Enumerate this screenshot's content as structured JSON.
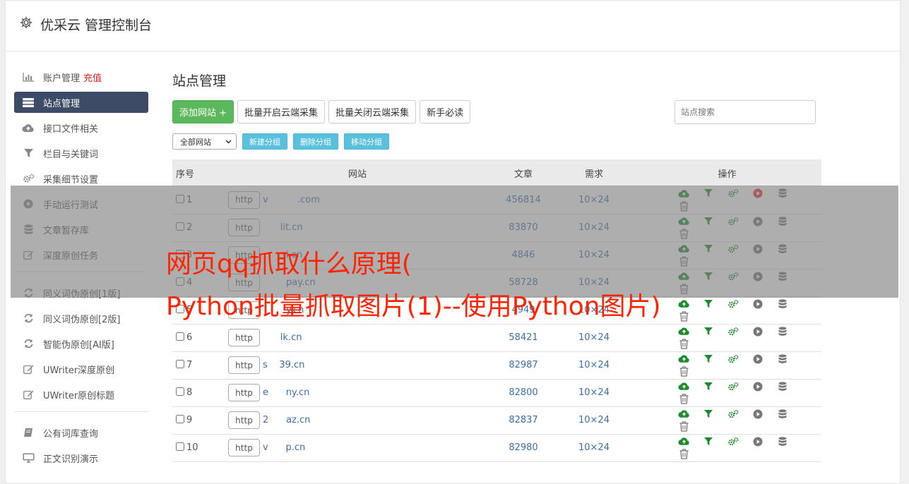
{
  "app": {
    "title": "优采云 管理控制台"
  },
  "sidebar": {
    "group1": [
      {
        "label": "账户管理",
        "extra": "充值",
        "icon": "bar-chart-icon"
      },
      {
        "label": "站点管理",
        "icon": "server-icon",
        "active": true
      },
      {
        "label": "接口文件相关",
        "icon": "cloud-upload-icon"
      },
      {
        "label": "栏目与关键词",
        "icon": "filter-icon"
      },
      {
        "label": "采集细节设置",
        "icon": "cogs-icon"
      },
      {
        "label": "手动运行测试",
        "icon": "play-icon"
      },
      {
        "label": "文章暂存库",
        "icon": "database-icon"
      },
      {
        "label": "深度原创任务",
        "icon": "edit-icon"
      }
    ],
    "group2": [
      {
        "label": "同义词伪原创[1版]",
        "icon": "refresh-icon"
      },
      {
        "label": "同义词伪原创[2版]",
        "icon": "refresh-icon"
      },
      {
        "label": "智能伪原创[AI版]",
        "icon": "refresh-icon"
      },
      {
        "label": "UWriter深度原创",
        "icon": "edit-icon"
      },
      {
        "label": "UWriter原创标题",
        "icon": "edit-icon"
      }
    ],
    "group3": [
      {
        "label": "公有词库查询",
        "icon": "book-icon"
      },
      {
        "label": "正文识别演示",
        "icon": "monitor-icon"
      }
    ]
  },
  "main": {
    "title": "站点管理",
    "toolbar": {
      "add_site": "添加网站 +",
      "batch_open": "批量开启云端采集",
      "batch_close": "批量关闭云端采集",
      "guide": "新手必读"
    },
    "search_placeholder": "站点搜索",
    "group_select": "全部网站",
    "group_buttons": {
      "new": "新建分组",
      "delete": "删除分组",
      "move": "移动分组"
    },
    "table": {
      "headers": {
        "no": "序号",
        "site": "网站",
        "articles": "文章",
        "demand": "需求",
        "ops": "操作"
      },
      "http_label": "http",
      "rows": [
        {
          "no": "1",
          "domain": "v          .com",
          "articles": "456814",
          "demand": "10×24",
          "running": true
        },
        {
          "no": "2",
          "domain": "      lit.cn",
          "articles": "83870",
          "demand": "10×24",
          "running": false
        },
        {
          "no": "3",
          "domain": "        i.cn",
          "articles": "4846",
          "demand": "10×24",
          "running": false
        },
        {
          "no": "4",
          "domain": "        pay.cn",
          "articles": "58728",
          "demand": "10×24",
          "running": false
        },
        {
          "no": "5",
          "domain": "        y.cn",
          "articles": "4949",
          "demand": "10×24",
          "running": false
        },
        {
          "no": "6",
          "domain": "      lk.cn",
          "articles": "58421",
          "demand": "10×24",
          "running": false
        },
        {
          "no": "7",
          "domain": "s    39.cn",
          "articles": "82987",
          "demand": "10×24",
          "running": false
        },
        {
          "no": "8",
          "domain": "e      ny.cn",
          "articles": "82800",
          "demand": "10×24",
          "running": false
        },
        {
          "no": "9",
          "domain": "2      az.cn",
          "articles": "82837",
          "demand": "10×24",
          "running": false
        },
        {
          "no": "10",
          "domain": "v      p.cn",
          "articles": "82980",
          "demand": "10×24",
          "running": false
        }
      ]
    }
  },
  "overlay": {
    "line1": "网页qq抓取什么原理(",
    "line2": "Python批量抓取图片(1)--使用Python图片)"
  },
  "colors": {
    "accent_green": "#5cb85c",
    "info_blue": "#5bc0de",
    "nav_active": "#3d4b66",
    "link_blue": "#3a6ea5",
    "headline_red": "#ff2200",
    "op_green": "#1e8a2e",
    "op_red": "#e0302a"
  }
}
